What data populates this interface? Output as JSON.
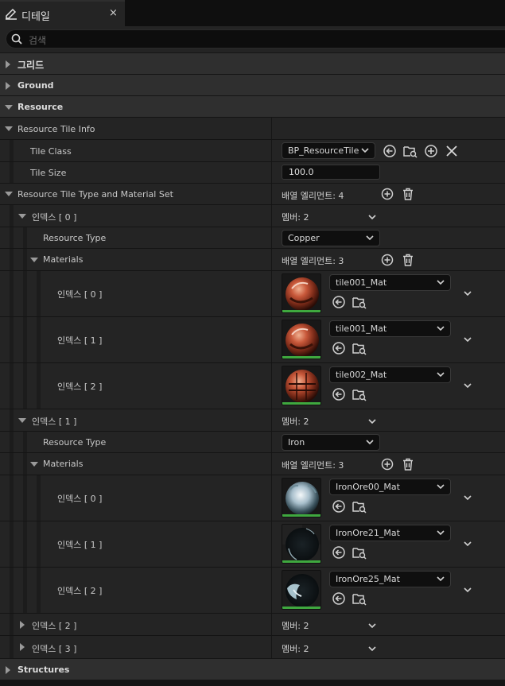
{
  "tab": {
    "title": "디테일",
    "close": "×"
  },
  "search": {
    "placeholder": "검색"
  },
  "categories": {
    "grid": "그리드",
    "ground": "Ground",
    "resource": "Resource",
    "structures": "Structures"
  },
  "resource_tile_info": {
    "label": "Resource Tile Info",
    "tile_class_label": "Tile Class",
    "tile_class_value": "BP_ResourceTile",
    "tile_size_label": "Tile Size",
    "tile_size_value": "100.0"
  },
  "type_material_set": {
    "label": "Resource Tile Type and Material Set",
    "elements": "배열 엘리먼트: 4"
  },
  "index_entries": [
    {
      "label": "인덱스 [ 0 ]",
      "members": "멤버: 2",
      "resource_type_label": "Resource Type",
      "resource_type": "Copper",
      "materials_label": "Materials",
      "materials_count": "배열 엘리먼트: 3",
      "materials": [
        {
          "index": "인덱스 [ 0 ]",
          "name": "tile001_Mat"
        },
        {
          "index": "인덱스 [ 1 ]",
          "name": "tile001_Mat"
        },
        {
          "index": "인덱스 [ 2 ]",
          "name": "tile002_Mat"
        }
      ]
    },
    {
      "label": "인덱스 [ 1 ]",
      "members": "멤버: 2",
      "resource_type_label": "Resource Type",
      "resource_type": "Iron",
      "materials_label": "Materials",
      "materials_count": "배열 엘리먼트: 3",
      "materials": [
        {
          "index": "인덱스 [ 0 ]",
          "name": "IronOre00_Mat"
        },
        {
          "index": "인덱스 [ 1 ]",
          "name": "IronOre21_Mat"
        },
        {
          "index": "인덱스 [ 2 ]",
          "name": "IronOre25_Mat"
        }
      ]
    },
    {
      "label": "인덱스 [ 2 ]",
      "members": "멤버: 2"
    },
    {
      "label": "인덱스 [ 3 ]",
      "members": "멤버: 2"
    }
  ],
  "colors": {
    "background": "#242424",
    "category_row": "#2f2f2f",
    "thumbnail_underline": "#3fa83f"
  }
}
